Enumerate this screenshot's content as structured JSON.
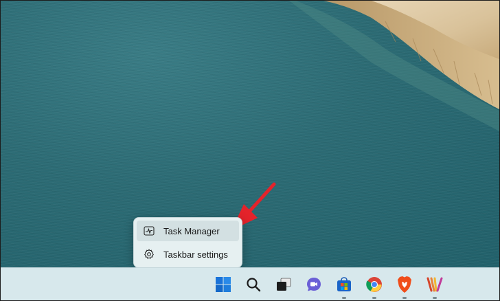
{
  "context_menu": {
    "items": [
      {
        "label": "Task Manager",
        "icon": "task-manager-icon"
      },
      {
        "label": "Taskbar settings",
        "icon": "gear-icon"
      }
    ]
  },
  "taskbar": {
    "icons": [
      "windows-start-icon",
      "search-icon",
      "task-view-icon",
      "teams-chat-icon",
      "microsoft-store-icon",
      "chrome-icon",
      "brave-icon",
      "pinned-app-icon"
    ]
  },
  "colors": {
    "taskbar_bg": "#d7e8ec",
    "menu_bg": "#e6f0f1",
    "annotation_arrow": "#e4232b",
    "wallpaper_water": "#2d6a72"
  }
}
